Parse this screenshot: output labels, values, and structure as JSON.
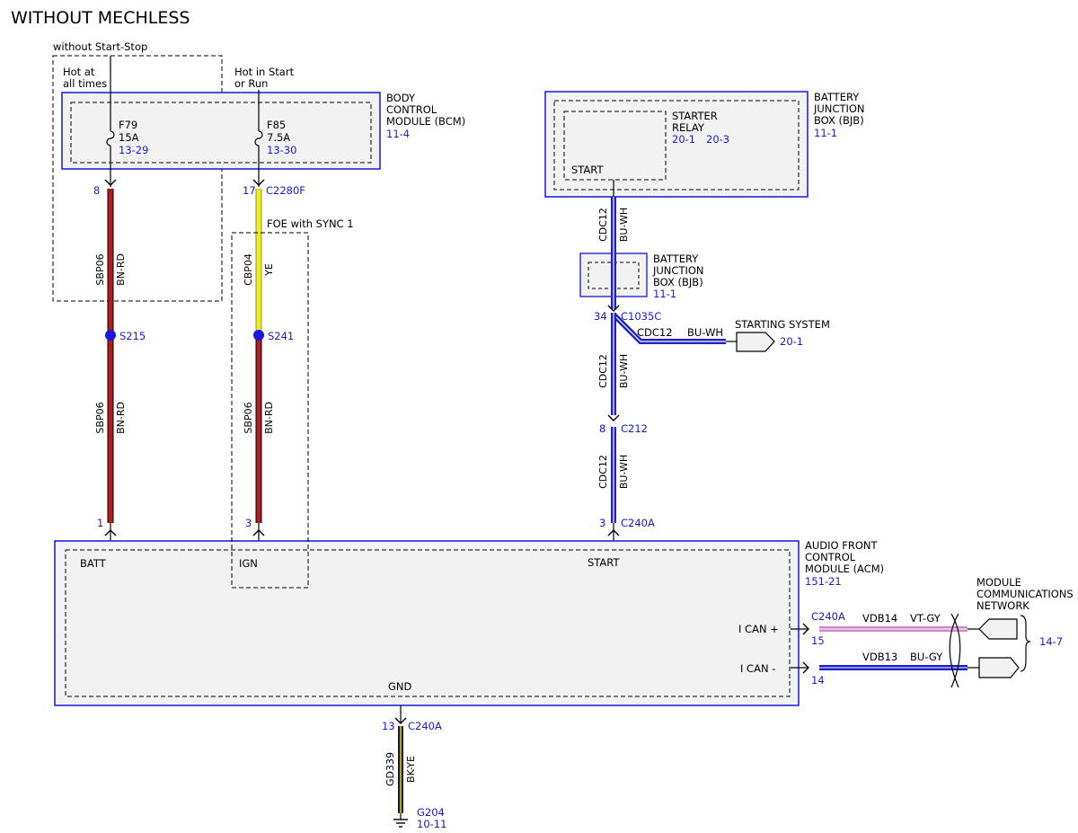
{
  "title": "WITHOUT MECHLESS",
  "boxes": {
    "start_stop": "without Start-Stop",
    "foe": "FOE with SYNC 1"
  },
  "power": {
    "hot_at_1": "Hot at",
    "hot_at_2": "all times",
    "hot_in_1": "Hot in Start",
    "hot_in_2": "or Run"
  },
  "bcm": {
    "name_1": "BODY",
    "name_2": "CONTROL",
    "name_3": "MODULE (BCM)",
    "ref": "11-4",
    "fuse1": {
      "id": "F79",
      "amp": "15A",
      "ref": "13-29"
    },
    "fuse2": {
      "id": "F85",
      "amp": "7.5A",
      "ref": "13-30"
    }
  },
  "bjb_top": {
    "name_1": "BATTERY",
    "name_2": "JUNCTION",
    "name_3": "BOX (BJB)",
    "ref": "11-1",
    "relay_1": "STARTER",
    "relay_2": "RELAY",
    "relay_ref1": "20-1",
    "relay_ref2": "20-3",
    "pin_start": "START"
  },
  "bjb_small": {
    "name_1": "BATTERY",
    "name_2": "JUNCTION",
    "name_3": "BOX (BJB)",
    "ref": "11-1"
  },
  "connectors": {
    "pin8": "8",
    "pin17": "17",
    "c2280f": "C2280F",
    "pin34": "34",
    "c1035c": "C1035C",
    "pin8b": "8",
    "c212": "C212",
    "pin1": "1",
    "pin3a": "3",
    "pin3b": "3",
    "c240a_top": "C240A",
    "pin13": "13",
    "c240a_gnd": "C240A",
    "c240a_can": "C240A",
    "pin15": "15",
    "pin14": "14"
  },
  "splices": {
    "s215": "S215",
    "s241": "S241"
  },
  "wires": {
    "w1a_circuit": "SBP06",
    "w1a_color": "BN-RD",
    "w1b_circuit": "SBP06",
    "w1b_color": "BN-RD",
    "w2a_circuit": "CBP04",
    "w2a_color": "YE",
    "w2b_circuit": "SBP06",
    "w2b_color": "BN-RD",
    "w3a_circuit": "CDC12",
    "w3a_color": "BU-WH",
    "w3b_circuit": "CDC12",
    "w3b_color": "BU-WH",
    "w3c_circuit": "CDC12",
    "w3c_color": "BU-WH",
    "w4_circuit": "CDC12",
    "w4_color": "BU-WH",
    "gnd_circuit": "GD339",
    "gnd_color": "BK-YE",
    "can_hi_circuit": "VDB14",
    "can_hi_color": "VT-GY",
    "can_lo_circuit": "VDB13",
    "can_lo_color": "BU-GY"
  },
  "starting_system": {
    "label": "STARTING SYSTEM",
    "ref": "20-1"
  },
  "acm": {
    "name_1": "AUDIO FRONT",
    "name_2": "CONTROL",
    "name_3": "MODULE (ACM)",
    "ref": "151-21",
    "batt": "BATT",
    "ign": "IGN",
    "start": "START",
    "gnd": "GND",
    "ican_hi": "I CAN +",
    "ican_lo": "I CAN -"
  },
  "network": {
    "label_1": "MODULE",
    "label_2": "COMMUNICATIONS",
    "label_3": "NETWORK",
    "ref": "14-7"
  },
  "ground": {
    "id": "G204",
    "ref": "10-11"
  },
  "colors": {
    "module_outline": "#2626d9",
    "ref_text": "#1a1acc",
    "wire_bn_rd": "#b01e1e",
    "wire_ye": "#f2f200",
    "wire_bu_wh": "#1f1fc8",
    "wire_vt_gy": "#cc88cc",
    "wire_bu_gy": "#1f1fc8",
    "wire_bk_ye": "#1a1a1a",
    "splice": "#1818e0",
    "module_fill": "#f2f2f2"
  }
}
